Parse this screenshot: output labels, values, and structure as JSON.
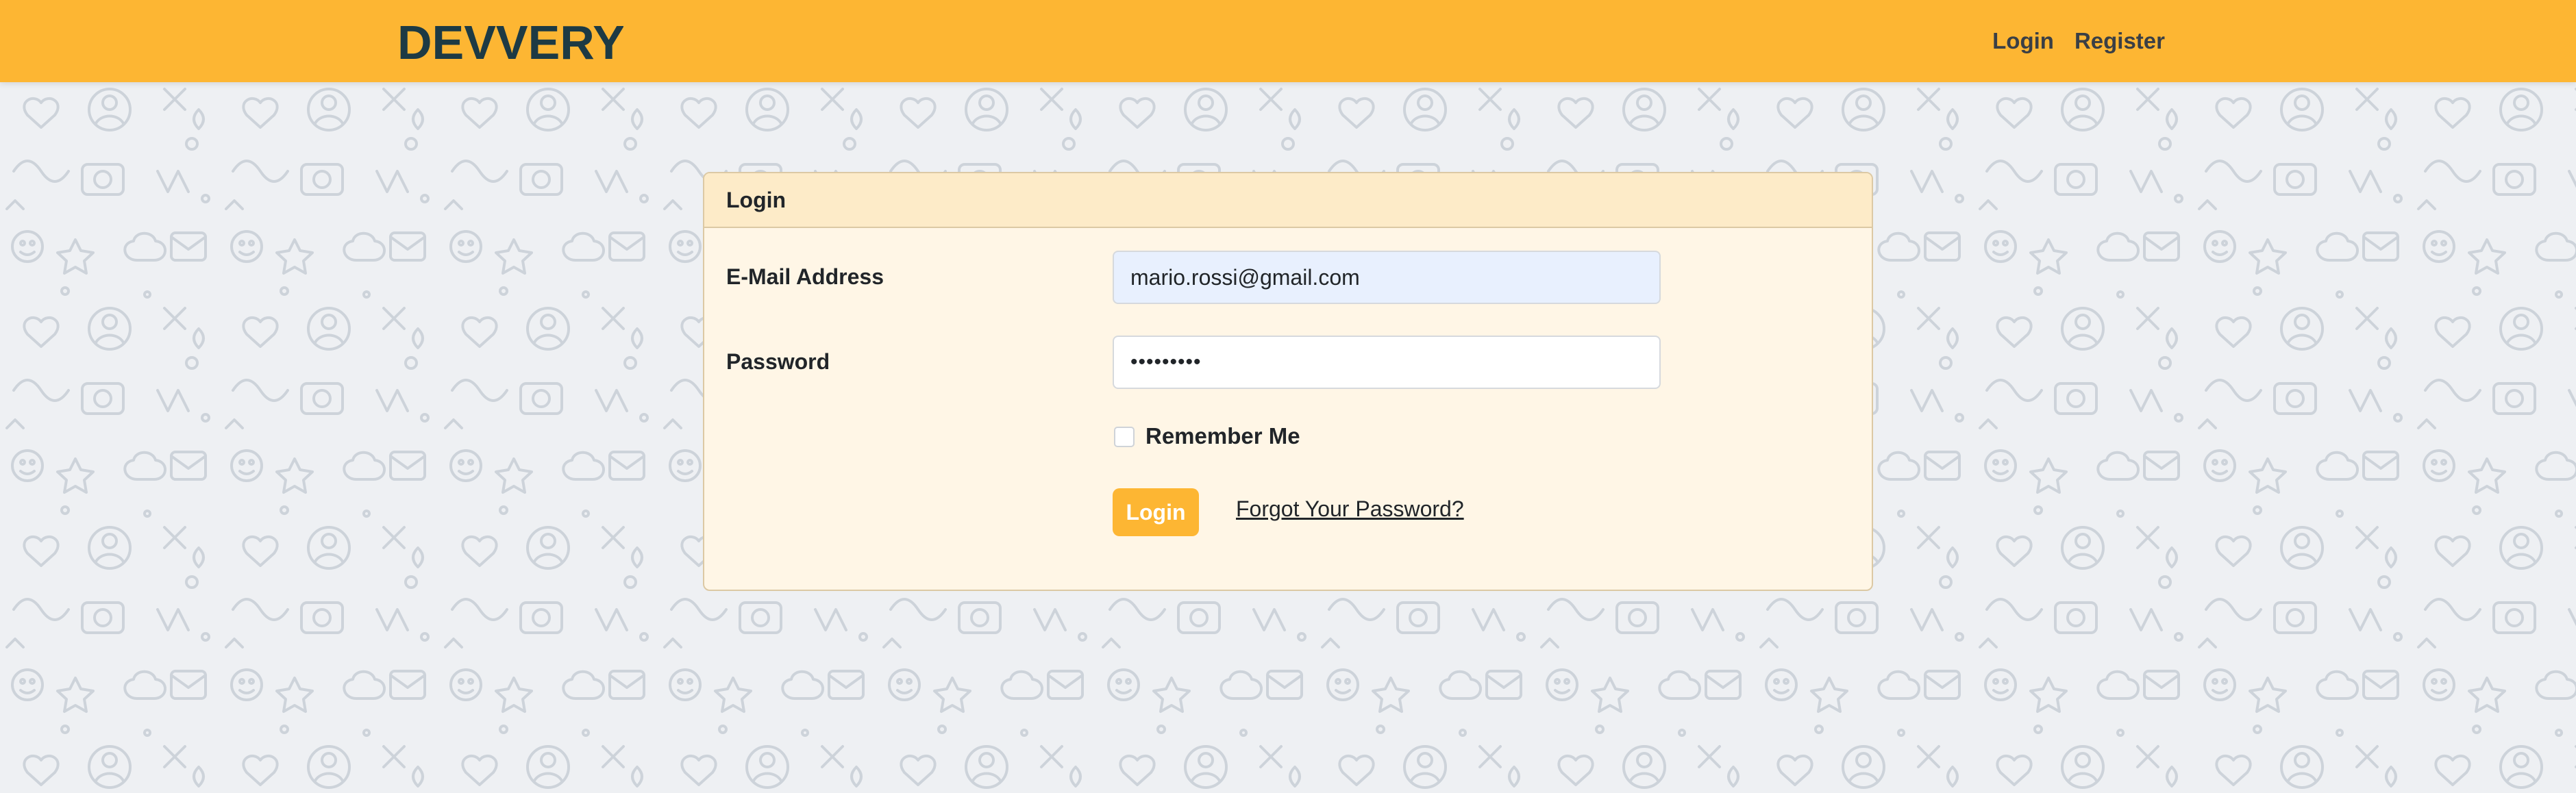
{
  "brand": {
    "name": "DEVVERY",
    "text_color": "#1d3a44"
  },
  "nav": {
    "links": [
      {
        "label": "Login"
      },
      {
        "label": "Register"
      }
    ]
  },
  "colors": {
    "accent": "#fdb633",
    "card_bg": "#fff6e6",
    "card_header_bg": "#fdebc8",
    "autofill_bg": "#e8f0fe",
    "pattern_stroke": "#cdd3da"
  },
  "login_card": {
    "title": "Login",
    "email_label": "E-Mail Address",
    "email_value": "mario.rossi@gmail.com",
    "password_label": "Password",
    "password_value": "•••••••••",
    "remember_label": "Remember Me",
    "remember_checked": false,
    "submit_label": "Login",
    "forgot_label": "Forgot Your Password?"
  },
  "icons": {
    "background": "doodle-pattern"
  }
}
